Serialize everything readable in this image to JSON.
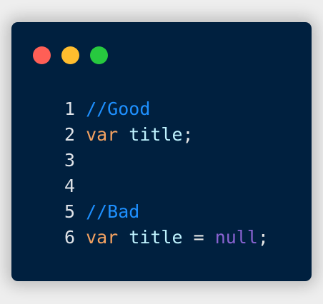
{
  "colors": {
    "background": "#eeeeee",
    "window": "#00203f",
    "dot_close": "#ff5f56",
    "dot_minimize": "#ffbd2e",
    "dot_maximize": "#27c93f",
    "line_number": "#dfe3e8",
    "comment": "#1e90ff",
    "keyword": "#f4a261",
    "identifier": "#bff3ff",
    "punctuation": "#e6e6e6",
    "literal": "#8a63d2"
  },
  "code": {
    "lines": [
      {
        "number": "1",
        "tokens": [
          {
            "text": "//Good",
            "kind": "comment"
          }
        ]
      },
      {
        "number": "2",
        "tokens": [
          {
            "text": "var",
            "kind": "keyword"
          },
          {
            "text": " ",
            "kind": "punctuation"
          },
          {
            "text": "title",
            "kind": "identifier"
          },
          {
            "text": ";",
            "kind": "punctuation"
          }
        ]
      },
      {
        "number": "3",
        "tokens": []
      },
      {
        "number": "4",
        "tokens": []
      },
      {
        "number": "5",
        "tokens": [
          {
            "text": "//Bad",
            "kind": "comment"
          }
        ]
      },
      {
        "number": "6",
        "tokens": [
          {
            "text": "var",
            "kind": "keyword"
          },
          {
            "text": " ",
            "kind": "punctuation"
          },
          {
            "text": "title",
            "kind": "identifier"
          },
          {
            "text": " = ",
            "kind": "punctuation"
          },
          {
            "text": "null",
            "kind": "literal"
          },
          {
            "text": ";",
            "kind": "punctuation"
          }
        ]
      }
    ]
  }
}
